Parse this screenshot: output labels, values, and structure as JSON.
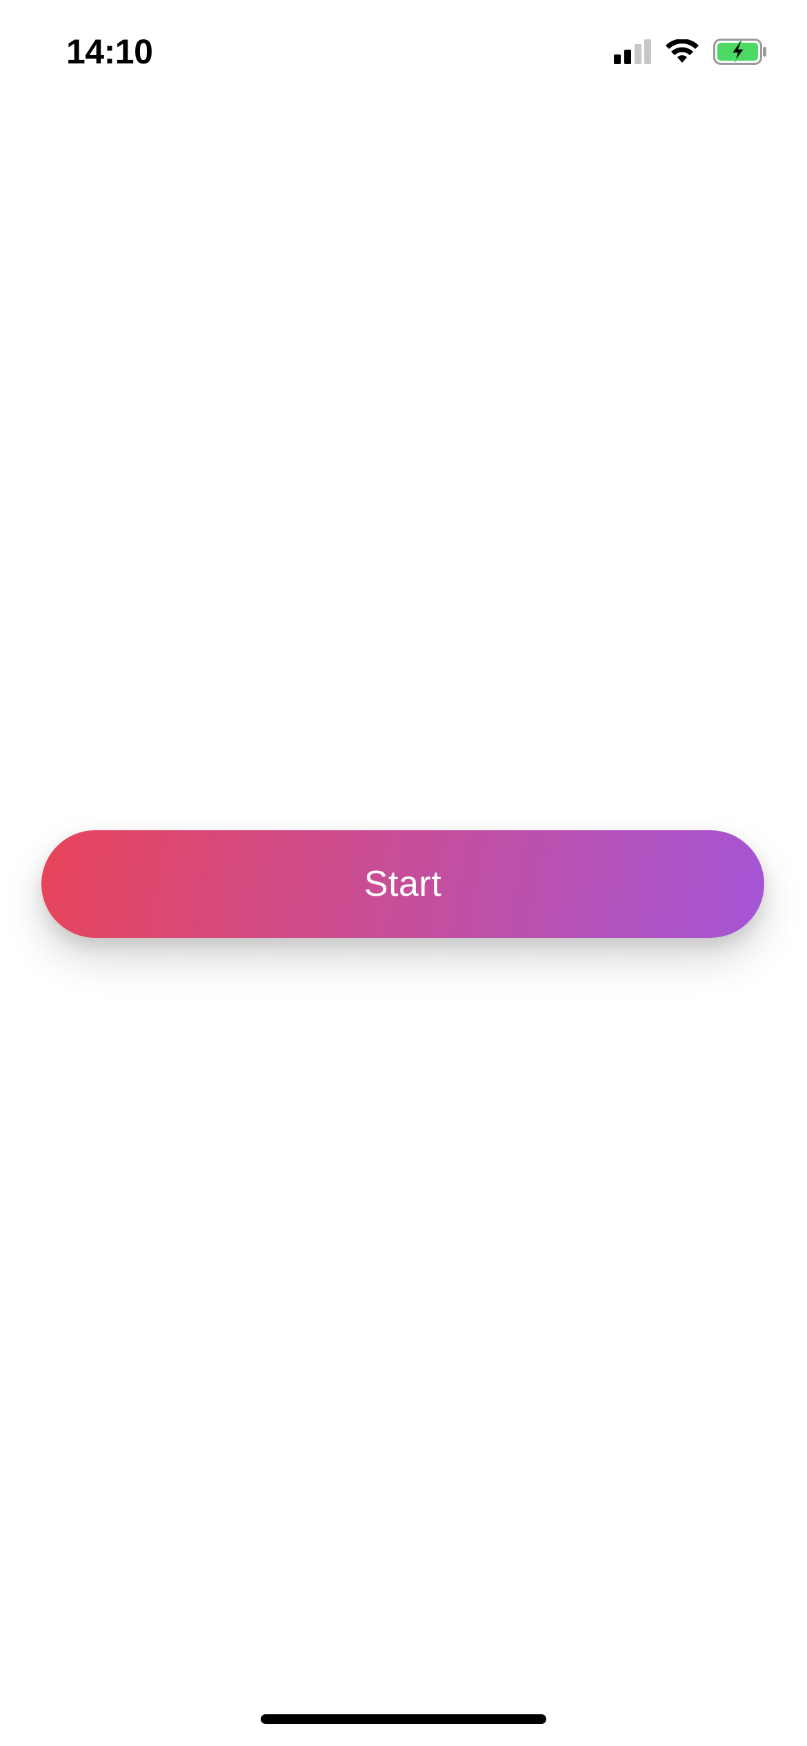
{
  "status_bar": {
    "time": "14:10",
    "icons": [
      "cellular-signal-icon",
      "wifi-icon",
      "battery-charging-icon"
    ],
    "battery_color": "#4cd964"
  },
  "main": {
    "start_button_label": "Start",
    "gradient_colors": [
      "#e8445a",
      "#c64e99",
      "#a455d6"
    ]
  }
}
